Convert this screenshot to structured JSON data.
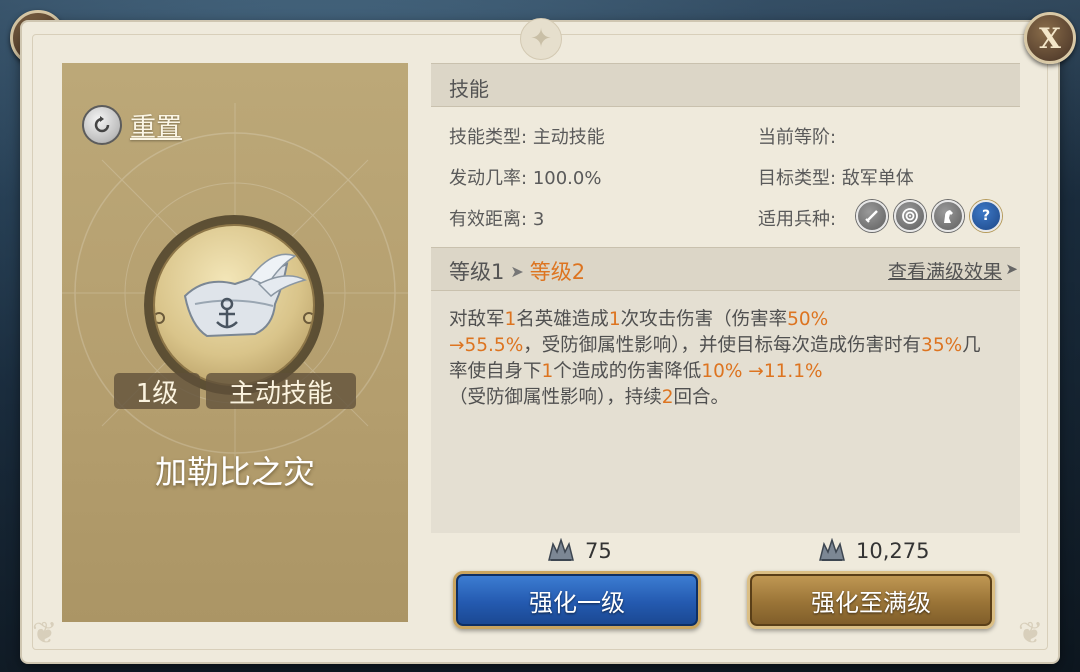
{
  "card": {
    "reset_label": "重置",
    "level_tag": "1级",
    "type_tag": "主动技能",
    "skill_name": "加勒比之灾"
  },
  "skills_section": {
    "title": "技能",
    "skill_type_key": "技能类型:",
    "skill_type_value": "主动技能",
    "trigger_rate_key": "发动几率:",
    "trigger_rate_value": "100.0%",
    "range_key": "有效距离:",
    "range_value": "3",
    "current_rank_key": "当前等阶:",
    "target_type_key": "目标类型:",
    "target_type_value": "敌军单体",
    "troop_type_key": "适用兵种:",
    "troop_icons": [
      "sword-icon",
      "target-icon",
      "horse-icon",
      "question-icon"
    ]
  },
  "level_section": {
    "current": "等级1",
    "next": "等级2",
    "view_max": "查看满级效果"
  },
  "description": {
    "p1": "对敌军",
    "n1": "1",
    "p2": "名英雄造成",
    "n2": "1",
    "p3": "次攻击伤害（伤害率",
    "n3": "50%",
    "n4": "→55.5%",
    "p4": "，受防御属性影响），并使目标每次造成伤害时有",
    "n5": "35%",
    "p5": "几率使自身下",
    "n6": "1",
    "p6": "个造成的伤害降低",
    "n7": "10% →11.1%",
    "p7": "（受防御属性影响），持续",
    "n8": "2",
    "p8": "回合。"
  },
  "costs": {
    "one_level": "75",
    "max_level": "10,275"
  },
  "buttons": {
    "upgrade_one": "强化一级",
    "upgrade_max": "强化至满级"
  },
  "colors": {
    "highlight": "#dd7420",
    "card_bg": "#b49e6e",
    "panel_bg": "#efeadc"
  }
}
